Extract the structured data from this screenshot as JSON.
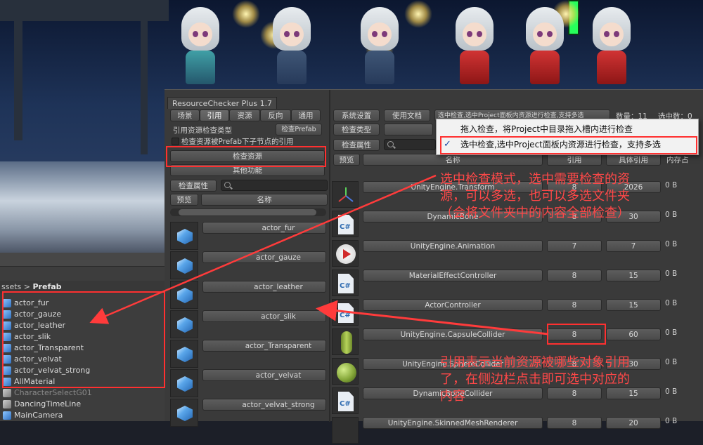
{
  "hierarchy": {
    "breadcrumb_parent": "ssets",
    "breadcrumb_sep": ">",
    "breadcrumb_current": "Prefab",
    "items": [
      "actor_fur",
      "actor_gauze",
      "actor_leather",
      "actor_slik",
      "actor_Transparent",
      "actor_velvat",
      "actor_velvat_strong",
      "AllMaterial"
    ],
    "scene_items": [
      "CharacterSelectG01",
      "DancingTimeLine",
      "MainCamera"
    ]
  },
  "window": {
    "title": "ResourceChecker Plus 1.7",
    "tabs": [
      "场景",
      "引用",
      "资源",
      "反向",
      "通用"
    ],
    "active_tab": "引用",
    "ref_type_label": "引用资源检查类型",
    "ref_type_value": "检查Prefab",
    "child_ref_label": "检查资源被Prefab下子节点的引用",
    "check_resource_btn": "检查资源",
    "other_func_btn": "其他功能",
    "check_attr_btn": "检查属性",
    "preview_btn": "预览",
    "name_btn": "名称",
    "prefab_list": [
      "actor_fur",
      "actor_gauze",
      "actor_leather",
      "actor_slik",
      "actor_Transparent",
      "actor_velvat",
      "actor_velvat_strong"
    ],
    "settings_btn": "系统设置",
    "docs_btn": "使用文档",
    "mode_select": "选中检查,选中Project面板内资源进行检查,支持多选",
    "count_label": "数量：11",
    "selected_label": "选中数：0",
    "check_type_btn": "检查类型",
    "right_check_attr_btn": "检查属性",
    "col_preview": "预览",
    "col_name": "名称",
    "col_ref": "引用",
    "col_spec": "具体引用",
    "col_mem": "内存占",
    "rows": [
      {
        "name": "UnityEngine.Transform",
        "ref": "8",
        "spec": "2026",
        "mem": "0 B"
      },
      {
        "name": "DynamicBone",
        "ref": "8",
        "spec": "30",
        "mem": "0 B"
      },
      {
        "name": "UnityEngine.Animation",
        "ref": "7",
        "spec": "7",
        "mem": "0 B"
      },
      {
        "name": "MaterialEffectController",
        "ref": "8",
        "spec": "15",
        "mem": "0 B"
      },
      {
        "name": "ActorController",
        "ref": "8",
        "spec": "15",
        "mem": "0 B"
      },
      {
        "name": "UnityEngine.CapsuleCollider",
        "ref": "8",
        "spec": "60",
        "mem": "0 B"
      },
      {
        "name": "UnityEngine.SphereCollider",
        "ref": "8",
        "spec": "30",
        "mem": "0 B"
      },
      {
        "name": "DynamicBoneCollider",
        "ref": "8",
        "spec": "15",
        "mem": "0 B"
      },
      {
        "name": "UnityEngine.SkinnedMeshRenderer",
        "ref": "8",
        "spec": "20",
        "mem": "0 B"
      }
    ]
  },
  "dropdown": {
    "options": [
      "拖入检查，将Project中目录拖入槽内进行检查",
      "选中检查,选中Project面板内资源进行检查，支持多选"
    ],
    "checked_index": 1,
    "check_mark": "✓"
  },
  "annotations": {
    "mode_note_line1": "选中检查模式，选中需要检查的资",
    "mode_note_line2": "源，可以多选，也可以多选文件夹",
    "mode_note_line3": "（会将文件夹中的内容全部检查）",
    "ref_note_line1": "引用表示当前资源被哪些对象引用",
    "ref_note_line2": "了，在侧边栏点击即可选中对应的",
    "ref_note_line3": "内容"
  },
  "colors": {
    "annotation": "#ff4848",
    "highlight_box": "#ff3030",
    "panel_bg": "#3a3a3a"
  }
}
